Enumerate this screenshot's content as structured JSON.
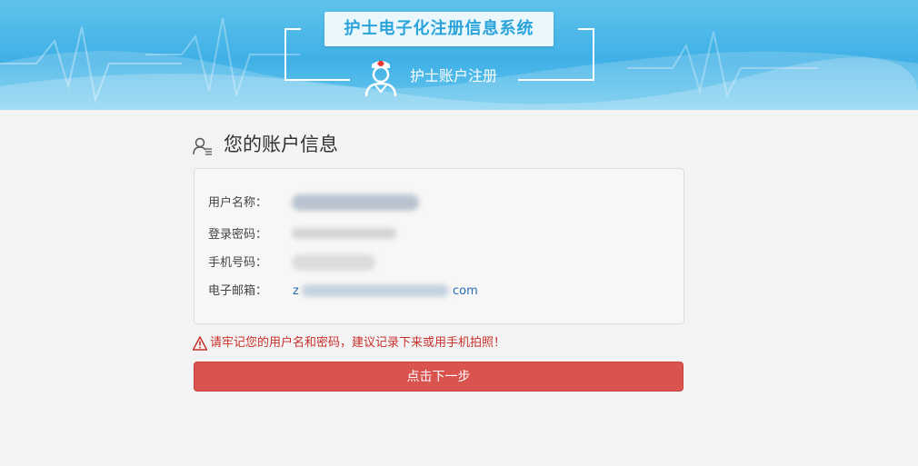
{
  "banner": {
    "system_title": "护士电子化注册信息系统",
    "sub_title": "护士账户注册"
  },
  "section": {
    "title": "您的账户信息"
  },
  "account": {
    "username_label": "用户名称：",
    "password_label": "登录密码：",
    "phone_label": "手机号码：",
    "email_label": "电子邮箱：",
    "email_prefix_visible": "z",
    "email_suffix_visible": "com"
  },
  "warning": {
    "text": "请牢记您的用户名和密码，建议记录下来或用手机拍照！"
  },
  "actions": {
    "next_label": "点击下一步"
  },
  "colors": {
    "banner_blue": "#3fb0e6",
    "title_blue": "#2aa3da",
    "danger_red": "#d9534f",
    "link_blue": "#2a6bb0"
  }
}
